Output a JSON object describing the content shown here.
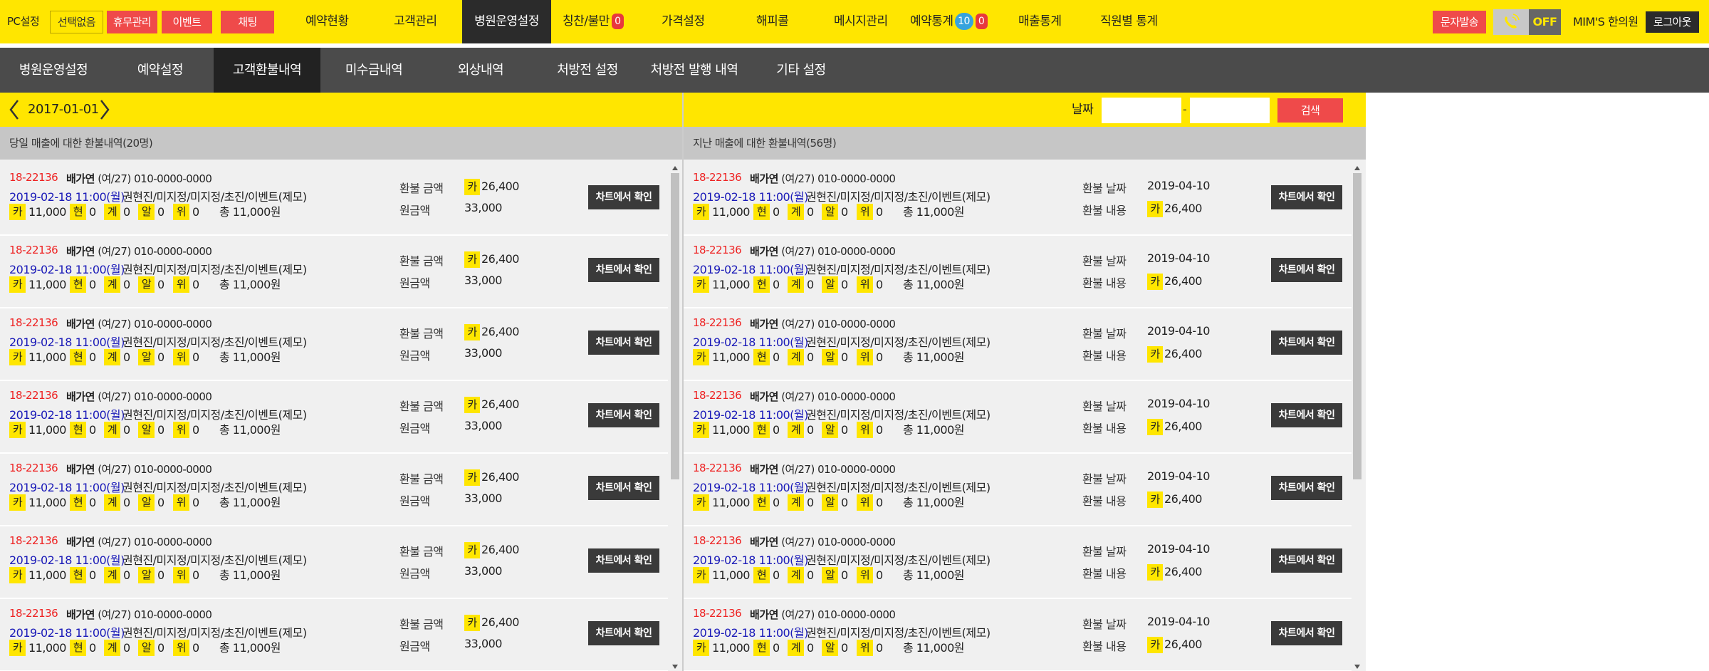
{
  "topbar": {
    "pc_setting": "PC설정",
    "select_none": "선택없음",
    "leave_mgmt": "휴무관리",
    "event": "이벤트",
    "chat": "채팅",
    "menu": [
      {
        "label": "예약현황"
      },
      {
        "label": "고객관리"
      },
      {
        "label": "병원운영설정"
      },
      {
        "label": "칭찬/불만",
        "badge": "0"
      },
      {
        "label": "가격설정"
      },
      {
        "label": "해피콜"
      },
      {
        "label": "메시지관리"
      },
      {
        "label": "예약통계",
        "badge_blue": "10",
        "badge": "0"
      },
      {
        "label": "매출통계"
      },
      {
        "label": "직원별 통계"
      }
    ],
    "sms_send": "문자발송",
    "call_status": "OFF",
    "clinic_name": "MIM'S 한의원",
    "logout": "로그아웃"
  },
  "subnav": [
    "병원운영설정",
    "예약설정",
    "고객환불내역",
    "미수금내역",
    "외상내역",
    "처방전 설정",
    "처방전 발행 내역",
    "기타 설정"
  ],
  "left_panel": {
    "current_date": "2017-01-01",
    "title": "당일 매출에 대한 환불내역(20명)",
    "label_refund_amount": "환불 금액",
    "label_original": "원금액",
    "button": "차트에서 확인"
  },
  "right_panel": {
    "date_label": "날짜",
    "date_from": "",
    "date_to": "",
    "date_sep": "-",
    "search_button": "검색",
    "title": "지난 매출에 대한 환불내역(56명)",
    "label_refund_date": "환불 날짜",
    "label_refund_content": "환불 내용",
    "button": "차트에서 확인"
  },
  "record": {
    "id": "18-22136",
    "name": "배가연",
    "gender_age": "(여/27)",
    "phone": "010-0000-0000",
    "datetime": "2019-02-18 11:00(월)",
    "detail": "권현진/미지정/미지정/초진/이벤트(제모)",
    "pay": [
      {
        "chip": "카",
        "value": "11,000"
      },
      {
        "chip": "현",
        "value": "0"
      },
      {
        "chip": "계",
        "value": "0"
      },
      {
        "chip": "알",
        "value": "0"
      },
      {
        "chip": "위",
        "value": "0"
      }
    ],
    "total": "총 11,000원",
    "refund_chip": "카",
    "refund_amount": "26,400",
    "original_amount": "33,000",
    "refund_date": "2019-04-10"
  },
  "left_rows": 7,
  "right_rows": 7
}
